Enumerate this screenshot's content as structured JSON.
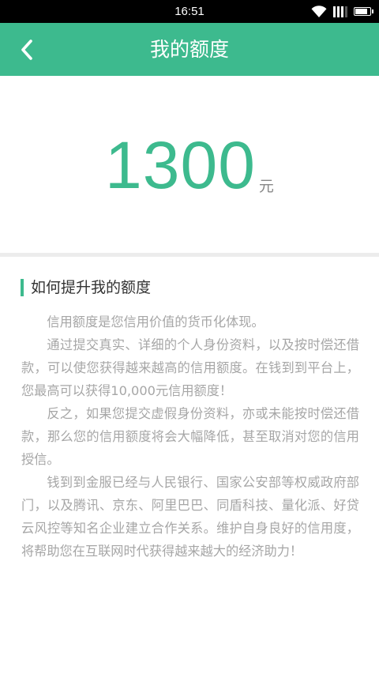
{
  "status_bar": {
    "time": "16:51",
    "icons": [
      "wifi-icon",
      "signal-icon",
      "battery-icon"
    ]
  },
  "header": {
    "back_icon": "chevron-left-icon",
    "title": "我的额度"
  },
  "amount": {
    "value": "1300",
    "unit": "元"
  },
  "info": {
    "heading": "如何提升我的额度",
    "paragraphs": [
      "信用额度是您信用价值的货币化体现。",
      "通过提交真实、详细的个人身份资料，以及按时偿还借款，可以使您获得越来越高的信用额度。在钱到到平台上，您最高可以获得10,000元信用额度！",
      "反之，如果您提交虚假身份资料，亦或未能按时偿还借款，那么您的信用额度将会大幅降低，甚至取消对您的信用授信。",
      "钱到到金服已经与人民银行、国家公安部等权威政府部门，以及腾讯、京东、阿里巴巴、同盾科技、量化派、好贷云风控等知名企业建立合作关系。维护自身良好的信用度，将帮助您在互联网时代获得越来越大的经济助力！"
    ]
  },
  "colors": {
    "brand": "#3dba8e",
    "body_text": "#a6a6a6",
    "heading_text": "#333333",
    "divider": "#ececec"
  }
}
